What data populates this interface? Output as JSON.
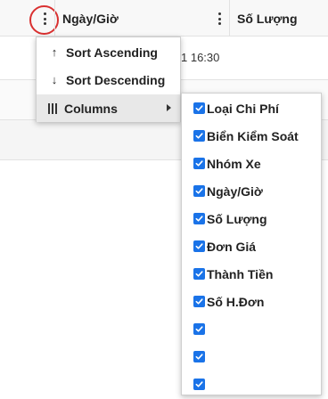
{
  "grid": {
    "headers": {
      "ngay_gio": "Ngày/Giờ",
      "so_luong": "Số Lượng"
    },
    "rows": [
      {
        "time_fragment": "1 16:30"
      }
    ]
  },
  "menu": {
    "sort_ascending": "Sort Ascending",
    "sort_descending": "Sort Descending",
    "columns": "Columns",
    "icons": {
      "sort_ascending": "arrow-up-icon",
      "sort_descending": "arrow-down-icon",
      "columns": "columns-icon",
      "submenu": "caret-right-icon"
    }
  },
  "columns_submenu": {
    "items": [
      {
        "label": "Loại Chi Phí",
        "checked": true
      },
      {
        "label": "Biển Kiểm Soát",
        "checked": true
      },
      {
        "label": "Nhóm Xe",
        "checked": true
      },
      {
        "label": "Ngày/Giờ",
        "checked": true
      },
      {
        "label": "Số Lượng",
        "checked": true
      },
      {
        "label": "Đơn Giá",
        "checked": true
      },
      {
        "label": "Thành Tiền",
        "checked": true
      },
      {
        "label": "Số H.Đơn",
        "checked": true
      },
      {
        "label": "",
        "checked": true
      },
      {
        "label": "",
        "checked": true
      },
      {
        "label": "",
        "checked": true
      }
    ]
  },
  "colors": {
    "checkbox": "#1a73e8",
    "highlight_circle": "#d93030",
    "active_item": "#e8e8e8"
  }
}
